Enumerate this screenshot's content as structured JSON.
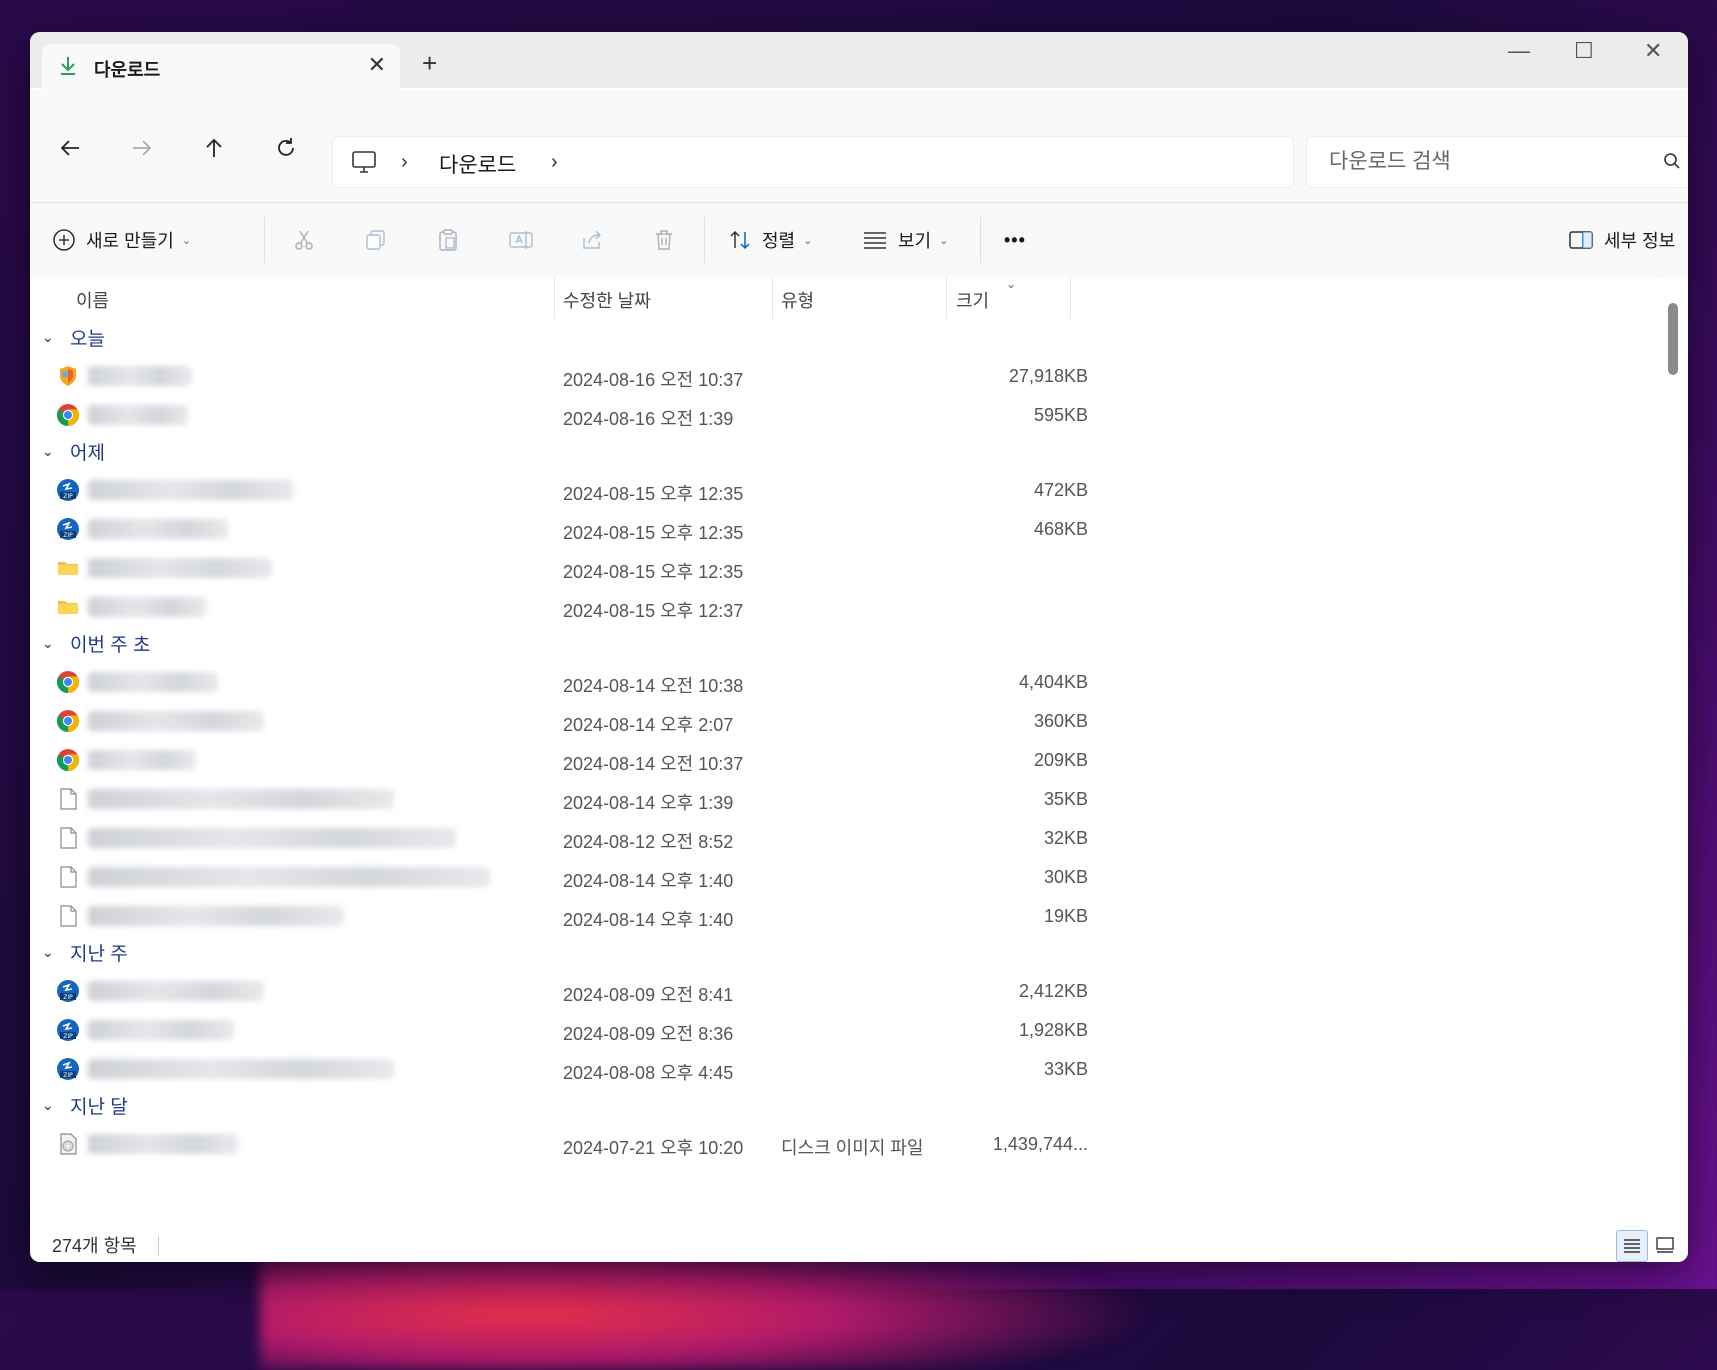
{
  "tab": {
    "title": "다운로드",
    "close": "✕",
    "new": "+"
  },
  "window_controls": {
    "minimize": "—",
    "maximize": "☐",
    "close": "✕"
  },
  "address": {
    "crumb": "다운로드"
  },
  "search": {
    "placeholder": "다운로드 검색"
  },
  "command_bar": {
    "new_label": "새로 만들기",
    "sort_label": "정렬",
    "view_label": "보기",
    "more_label": "•••",
    "details_label": "세부 정보"
  },
  "columns": {
    "name": "이름",
    "date": "수정한 날짜",
    "type": "유형",
    "size": "크기"
  },
  "groups": [
    {
      "label": "오늘",
      "rows": [
        {
          "icon": "installer-icon",
          "date": "2024-08-16 오전 10:37",
          "type": "",
          "size": "27,918KB"
        },
        {
          "icon": "chrome-icon",
          "date": "2024-08-16 오전 1:39",
          "type": "",
          "size": "595KB"
        }
      ]
    },
    {
      "label": "어제",
      "rows": [
        {
          "icon": "zip-icon",
          "date": "2024-08-15 오후 12:35",
          "type": "",
          "size": "472KB"
        },
        {
          "icon": "zip-icon",
          "date": "2024-08-15 오후 12:35",
          "type": "",
          "size": "468KB"
        },
        {
          "icon": "folder-icon",
          "date": "2024-08-15 오후 12:35",
          "type": "",
          "size": ""
        },
        {
          "icon": "folder-icon",
          "date": "2024-08-15 오후 12:37",
          "type": "",
          "size": ""
        }
      ]
    },
    {
      "label": "이번 주 초",
      "rows": [
        {
          "icon": "chrome-icon",
          "date": "2024-08-14 오전 10:38",
          "type": "",
          "size": "4,404KB"
        },
        {
          "icon": "chrome-icon",
          "date": "2024-08-14 오후 2:07",
          "type": "",
          "size": "360KB"
        },
        {
          "icon": "chrome-icon",
          "date": "2024-08-14 오전 10:37",
          "type": "",
          "size": "209KB"
        },
        {
          "icon": "file-icon",
          "date": "2024-08-14 오후 1:39",
          "type": "",
          "size": "35KB"
        },
        {
          "icon": "file-icon",
          "date": "2024-08-12 오전 8:52",
          "type": "",
          "size": "32KB"
        },
        {
          "icon": "file-icon",
          "date": "2024-08-14 오후 1:40",
          "type": "",
          "size": "30KB"
        },
        {
          "icon": "file-icon",
          "date": "2024-08-14 오후 1:40",
          "type": "",
          "size": "19KB"
        }
      ]
    },
    {
      "label": "지난 주",
      "rows": [
        {
          "icon": "zip-icon",
          "date": "2024-08-09 오전 8:41",
          "type": "",
          "size": "2,412KB"
        },
        {
          "icon": "zip-icon",
          "date": "2024-08-09 오전 8:36",
          "type": "",
          "size": "1,928KB"
        },
        {
          "icon": "zip-icon",
          "date": "2024-08-08 오후 4:45",
          "type": "",
          "size": "33KB"
        }
      ]
    },
    {
      "label": "지난 달",
      "rows": [
        {
          "icon": "disc-image-icon",
          "date": "2024-07-21 오후 10:20",
          "type": "디스크 이미지 파일",
          "size": "1,439,744..."
        }
      ]
    }
  ],
  "status": {
    "count": "274개 항목"
  },
  "colors": {
    "accent": "#0067c0",
    "group_text": "#1e3a8a"
  }
}
